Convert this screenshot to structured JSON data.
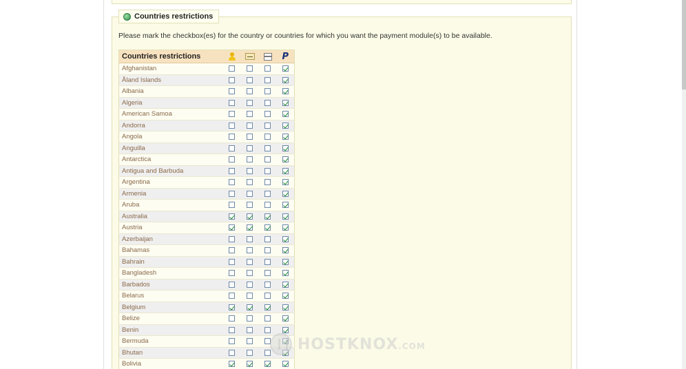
{
  "legend_title": "Countries restrictions",
  "intro_text": "Please mark the checkbox(es) for the country or countries for which you want the payment module(s) to be available.",
  "table_header": "Countries restrictions",
  "module_icons": [
    "user-module-icon",
    "check-module-icon",
    "card-module-icon",
    "paypal-icon"
  ],
  "paypal_glyph": "P",
  "rows": [
    {
      "country": "Afghanistan",
      "checks": [
        false,
        false,
        false,
        true
      ]
    },
    {
      "country": "Åland Islands",
      "checks": [
        false,
        false,
        false,
        true
      ]
    },
    {
      "country": "Albania",
      "checks": [
        false,
        false,
        false,
        true
      ]
    },
    {
      "country": "Algeria",
      "checks": [
        false,
        false,
        false,
        true
      ]
    },
    {
      "country": "American Samoa",
      "checks": [
        false,
        false,
        false,
        true
      ]
    },
    {
      "country": "Andorra",
      "checks": [
        false,
        false,
        false,
        true
      ]
    },
    {
      "country": "Angola",
      "checks": [
        false,
        false,
        false,
        true
      ]
    },
    {
      "country": "Anguilla",
      "checks": [
        false,
        false,
        false,
        true
      ]
    },
    {
      "country": "Antarctica",
      "checks": [
        false,
        false,
        false,
        true
      ]
    },
    {
      "country": "Antigua and Barbuda",
      "checks": [
        false,
        false,
        false,
        true
      ]
    },
    {
      "country": "Argentina",
      "checks": [
        false,
        false,
        false,
        true
      ]
    },
    {
      "country": "Armenia",
      "checks": [
        false,
        false,
        false,
        true
      ]
    },
    {
      "country": "Aruba",
      "checks": [
        false,
        false,
        false,
        true
      ]
    },
    {
      "country": "Australia",
      "checks": [
        true,
        true,
        true,
        true
      ]
    },
    {
      "country": "Austria",
      "checks": [
        true,
        true,
        true,
        true
      ]
    },
    {
      "country": "Azerbaijan",
      "checks": [
        false,
        false,
        false,
        true
      ]
    },
    {
      "country": "Bahamas",
      "checks": [
        false,
        false,
        false,
        true
      ]
    },
    {
      "country": "Bahrain",
      "checks": [
        false,
        false,
        false,
        true
      ]
    },
    {
      "country": "Bangladesh",
      "checks": [
        false,
        false,
        false,
        true
      ]
    },
    {
      "country": "Barbados",
      "checks": [
        false,
        false,
        false,
        true
      ]
    },
    {
      "country": "Belarus",
      "checks": [
        false,
        false,
        false,
        true
      ]
    },
    {
      "country": "Belgium",
      "checks": [
        true,
        true,
        true,
        true
      ]
    },
    {
      "country": "Belize",
      "checks": [
        false,
        false,
        false,
        true
      ]
    },
    {
      "country": "Benin",
      "checks": [
        false,
        false,
        false,
        true
      ]
    },
    {
      "country": "Bermuda",
      "checks": [
        false,
        false,
        false,
        true
      ]
    },
    {
      "country": "Bhutan",
      "checks": [
        false,
        false,
        false,
        true
      ]
    },
    {
      "country": "Bolivia",
      "checks": [
        true,
        true,
        true,
        true
      ]
    }
  ],
  "watermark": {
    "brand": "HOSTKNOX",
    "suffix": ".COM"
  },
  "colors": {
    "panel_bg": "#fbfbe7",
    "header_bg": "#f7e2c0",
    "check_green": "#1d8a2e",
    "paypal_blue": "#17307a"
  }
}
